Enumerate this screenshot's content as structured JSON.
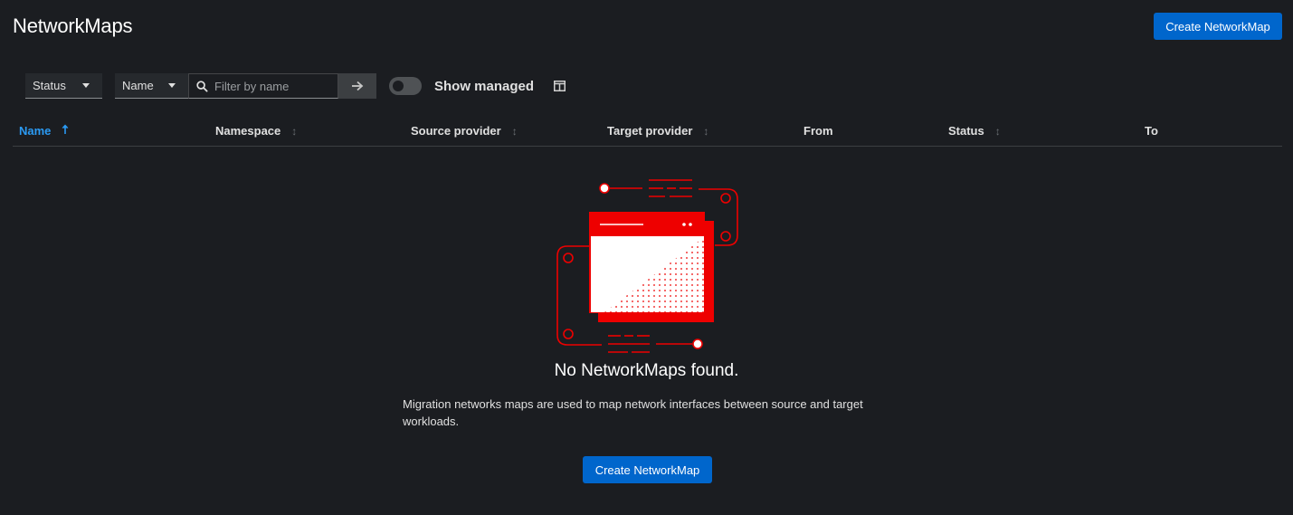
{
  "page": {
    "title": "NetworkMaps",
    "create_button": "Create NetworkMap"
  },
  "toolbar": {
    "filter_type": "Status",
    "filter_field": "Name",
    "search_placeholder": "Filter by name",
    "toggle_label": "Show managed",
    "toggle_on": false
  },
  "table": {
    "columns": [
      {
        "label": "Name",
        "sortable": true,
        "active": true
      },
      {
        "label": "Namespace",
        "sortable": true,
        "active": false
      },
      {
        "label": "Source provider",
        "sortable": true,
        "active": false
      },
      {
        "label": "Target provider",
        "sortable": true,
        "active": false
      },
      {
        "label": "From",
        "sortable": false,
        "active": false
      },
      {
        "label": "Status",
        "sortable": true,
        "active": false
      },
      {
        "label": "To",
        "sortable": false,
        "active": false
      }
    ]
  },
  "empty_state": {
    "title": "No NetworkMaps found.",
    "body": "Migration networks maps are used to map network interfaces between source and target workloads.",
    "button": "Create NetworkMap"
  },
  "colors": {
    "accent": "#0066cc",
    "active_sort": "#2b9af3",
    "illustration_red": "#ee0000"
  }
}
